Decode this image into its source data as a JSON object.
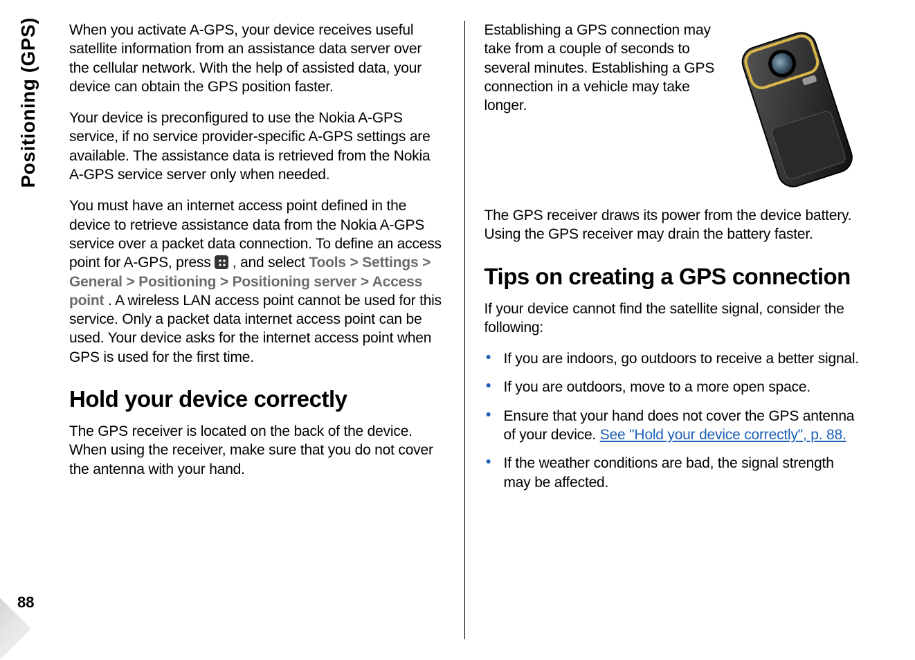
{
  "side_tab": "Positioning (GPS)",
  "page_number": "88",
  "left": {
    "p1": "When you activate A-GPS, your device receives useful satellite information from an assistance data server over the cellular network. With the help of assisted data, your device can obtain the GPS position faster.",
    "p2": "Your device is preconfigured to use the Nokia A-GPS service, if no service provider-specific A-GPS settings are available. The assistance data is retrieved from the Nokia A-GPS service server only when needed.",
    "p3_a": "You must have an internet access point defined in the device to retrieve assistance data from the Nokia A-GPS service over a packet data connection. To define an access point for A-GPS, press ",
    "p3_b": " , and select ",
    "menu_path": "Tools > Settings > General > Positioning > Positioning server > Access point",
    "p3_c": ". A wireless LAN access point cannot be used for this service. Only a packet data internet access point can be used. Your device asks for the internet access point when GPS is used for the first time.",
    "h_hold": "Hold your device correctly",
    "p_hold": "The GPS receiver is located on the back of the device. When using the receiver, make sure that you do not cover the antenna with your hand."
  },
  "right": {
    "p_estab_a": "Establishing a GPS connection may take from a couple of seconds to several minutes. Establishing a GPS connection in a vehicle may take longer.",
    "p_power": "The GPS receiver draws its power from the device battery. Using the GPS receiver may drain the battery faster.",
    "h_tips": "Tips on creating a GPS connection",
    "p_tips_intro": "If your device cannot find the satellite signal, consider the following:",
    "tips": [
      "If you are indoors, go outdoors to receive a better signal.",
      "If you are outdoors, move to a more open space.",
      "Ensure that your hand does not cover the GPS antenna of your device. ",
      "If the weather conditions are bad, the signal strength may be affected."
    ],
    "xref": "See \"Hold your device correctly\", p. 88."
  }
}
